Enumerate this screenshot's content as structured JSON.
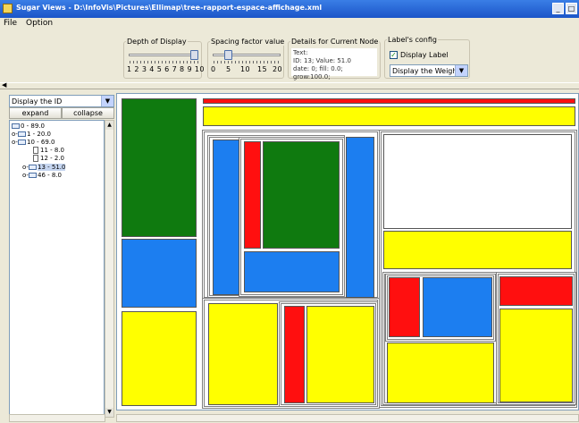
{
  "window": {
    "title": "Sugar Views - D:\\InfoVis\\Pictures\\Ellimap\\tree-rapport-espace-affichage.xml",
    "minimize_label": "_",
    "maximize_label": "□"
  },
  "menu": {
    "file": "File",
    "option": "Option"
  },
  "controls": {
    "depth": {
      "label": "Depth of Display",
      "ticks": "1 2 3 4 5 6 7 8 9 10",
      "value": 10
    },
    "spacing": {
      "label": "Spacing factor value",
      "ticks": [
        "0",
        "5",
        "10",
        "15",
        "20"
      ],
      "value": 2
    },
    "details": {
      "label": "Details for Current Node",
      "lines": [
        "Text:",
        "ID: 13; Value: 51.0",
        "date: 0; fill: 0.0; grow:100.0;"
      ]
    },
    "labels_config": {
      "label": "Label's config",
      "display_label": "Display Label",
      "display_label_checked": true,
      "weight_select": "Display the Weight"
    }
  },
  "left": {
    "id_select": "Display the ID",
    "expand": "expand",
    "collapse": "collapse",
    "tree": [
      {
        "label": "0 - 89.0",
        "type": "folder",
        "toggle": "",
        "level": 0
      },
      {
        "label": "1 - 20.0",
        "type": "folder",
        "toggle": "o-",
        "level": 0
      },
      {
        "label": "10 - 69.0",
        "type": "folder",
        "toggle": "o-",
        "level": 0
      },
      {
        "label": "11 - 8.0",
        "type": "file",
        "toggle": "",
        "level": 2
      },
      {
        "label": "12 - 2.0",
        "type": "file",
        "toggle": "",
        "level": 2
      },
      {
        "label": "13 - 51.0",
        "type": "folder",
        "toggle": "o-",
        "level": 1,
        "selected": true
      },
      {
        "label": "46 - 8.0",
        "type": "folder",
        "toggle": "o-",
        "level": 1
      }
    ]
  },
  "colors": {
    "green": "#0f7a0f",
    "blue": "#1c7ef0",
    "red": "#ff0f0f",
    "yellow": "#ffff00",
    "white": "#ffffff"
  },
  "icons": {
    "app": "sugar-app-icon",
    "folder": "folder-icon",
    "file": "file-icon",
    "dropdown": "chevron-down-icon",
    "check": "check-icon"
  }
}
